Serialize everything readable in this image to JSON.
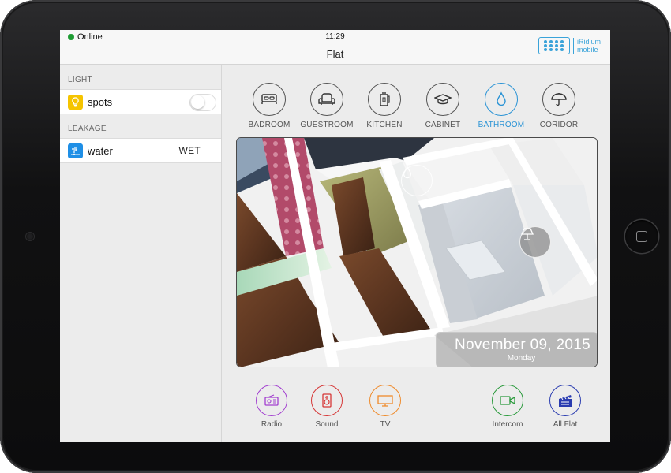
{
  "status": {
    "connection": "Online",
    "time": "11:29"
  },
  "header": {
    "title": "Flat",
    "logo_line1": "iRidium",
    "logo_line2": "mobile"
  },
  "sidebar": {
    "sections": [
      {
        "label": "LIGHT",
        "item_label": "spots",
        "icon": "lightbulb-icon",
        "icon_color": "#f5c400",
        "toggle_on": false
      },
      {
        "label": "LEAKAGE",
        "item_label": "water",
        "icon": "faucet-icon",
        "icon_color": "#1f8fe6",
        "value": "WET"
      }
    ]
  },
  "rooms": [
    {
      "label": "BADROOM",
      "icon": "bed-icon",
      "active": false
    },
    {
      "label": "GUESTROOM",
      "icon": "armchair-icon",
      "active": false
    },
    {
      "label": "KITCHEN",
      "icon": "kettle-icon",
      "active": false
    },
    {
      "label": "CABINET",
      "icon": "graduation-cap-icon",
      "active": false
    },
    {
      "label": "BATHROOM",
      "icon": "water-drop-icon",
      "active": true
    },
    {
      "label": "CORIDOR",
      "icon": "umbrella-icon",
      "active": false
    }
  ],
  "plan": {
    "date": "November 09, 2015",
    "weekday": "Monday",
    "overlay_icons": [
      "water-drop-icon",
      "lamp-icon"
    ]
  },
  "bottom_buttons": [
    {
      "label": "Radio",
      "icon": "radio-icon",
      "color": "#a23fd0"
    },
    {
      "label": "Sound",
      "icon": "speaker-icon",
      "color": "#d63636"
    },
    {
      "label": "TV",
      "icon": "tv-icon",
      "color": "#ef8a2a"
    },
    {
      "label": "Intercom",
      "icon": "video-camera-icon",
      "color": "#2a9a3c"
    },
    {
      "label": "All Flat",
      "icon": "clapperboard-icon",
      "color": "#2a3cb0"
    }
  ],
  "colors": {
    "accent": "#2a93d5",
    "online": "#1e9c33"
  }
}
